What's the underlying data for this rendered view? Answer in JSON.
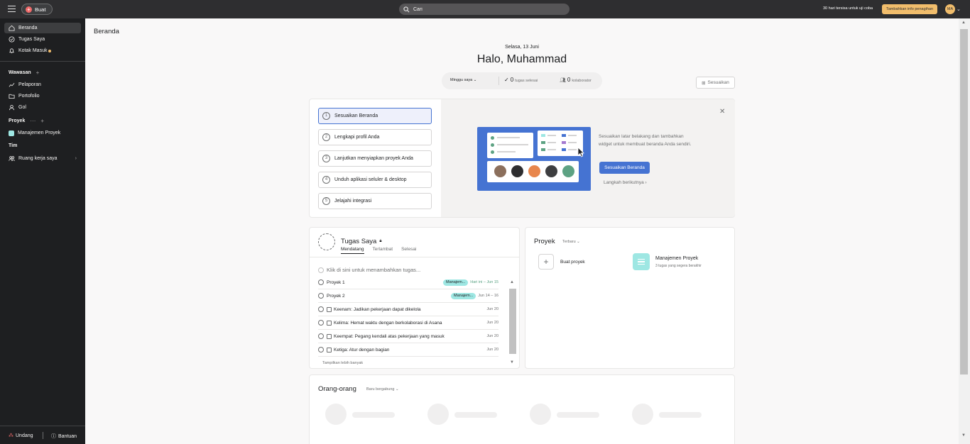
{
  "topbar": {
    "create_label": "Buat",
    "search_placeholder": "Cari",
    "trial_text": "30 hari tersisa untuk uji coba",
    "billing_button": "Tambahkan info penagihan",
    "avatar_initials": "MA"
  },
  "sidebar": {
    "items": [
      {
        "label": "Beranda",
        "icon": "home-icon"
      },
      {
        "label": "Tugas Saya",
        "icon": "check-circle-icon"
      },
      {
        "label": "Kotak Masuk",
        "icon": "bell-icon"
      }
    ],
    "insights_label": "Wawasan",
    "insights_items": [
      {
        "label": "Pelaporan",
        "icon": "chart-line-icon"
      },
      {
        "label": "Portofolio",
        "icon": "folder-icon"
      },
      {
        "label": "Gol",
        "icon": "person-icon"
      }
    ],
    "projects_label": "Proyek",
    "project_item": "Manajemen Proyek",
    "team_label": "Tim",
    "team_item": "Ruang kerja saya",
    "invite_label": "Undang",
    "help_label": "Bantuan"
  },
  "main": {
    "page_title": "Beranda",
    "date": "Selasa, 13 Juni",
    "greeting": "Halo, Muhammad",
    "week_selector": "Minggu saya",
    "tasks_done_count": "0",
    "tasks_done_label": "tugas selesai",
    "collab_count": "0",
    "collab_label": "kolaborator",
    "customize_label": "Sesuaikan"
  },
  "onboarding": {
    "steps": [
      {
        "num": "1",
        "label": "Sesuaikan Beranda"
      },
      {
        "num": "2",
        "label": "Lengkapi profil Anda"
      },
      {
        "num": "3",
        "label": "Lanjutkan menyiapkan proyek Anda"
      },
      {
        "num": "4",
        "label": "Unduh aplikasi seluler & desktop"
      },
      {
        "num": "5",
        "label": "Jelajahi integrasi"
      }
    ],
    "description": "Sesuaikan latar belakang dan tambahkan widget untuk membuat beranda Anda sendiri.",
    "primary_button": "Sesuaikan Beranda",
    "next_link": "Langkah berikutnya"
  },
  "my_tasks": {
    "title": "Tugas Saya",
    "tabs": [
      "Mendatang",
      "Terlambat",
      "Selesai"
    ],
    "add_prompt": "Klik di sini untuk menambahkan tugas...",
    "rows": [
      {
        "name": "Proyek 1",
        "tag": "Manajem...",
        "due": "Hari ini – Jun 15"
      },
      {
        "name": "Proyek 2",
        "tag": "Manajem...",
        "due": "Jun 14 – 16"
      },
      {
        "name": "Keenam: Jadikan pekerjaan dapat dikelola",
        "tag": "",
        "due": "Jun 20"
      },
      {
        "name": "Kelima: Hemat waktu dengan berkolaborasi di Asana",
        "tag": "",
        "due": "Jun 20"
      },
      {
        "name": "Keempat: Pegang kendali atas pekerjaan yang masuk",
        "tag": "",
        "due": "Jun 20"
      },
      {
        "name": "Ketiga: Atur dengan bagian",
        "tag": "",
        "due": "Jun 20"
      }
    ],
    "show_more": "Tampilkan lebih banyak"
  },
  "projects": {
    "title": "Proyek",
    "filter": "Terbaru",
    "new_project": "Buat proyek",
    "project_name": "Manajemen Proyek",
    "project_sub": "3 tugas yang segera berakhir"
  },
  "people": {
    "title": "Orang-orang",
    "filter": "Baru bergabung"
  }
}
